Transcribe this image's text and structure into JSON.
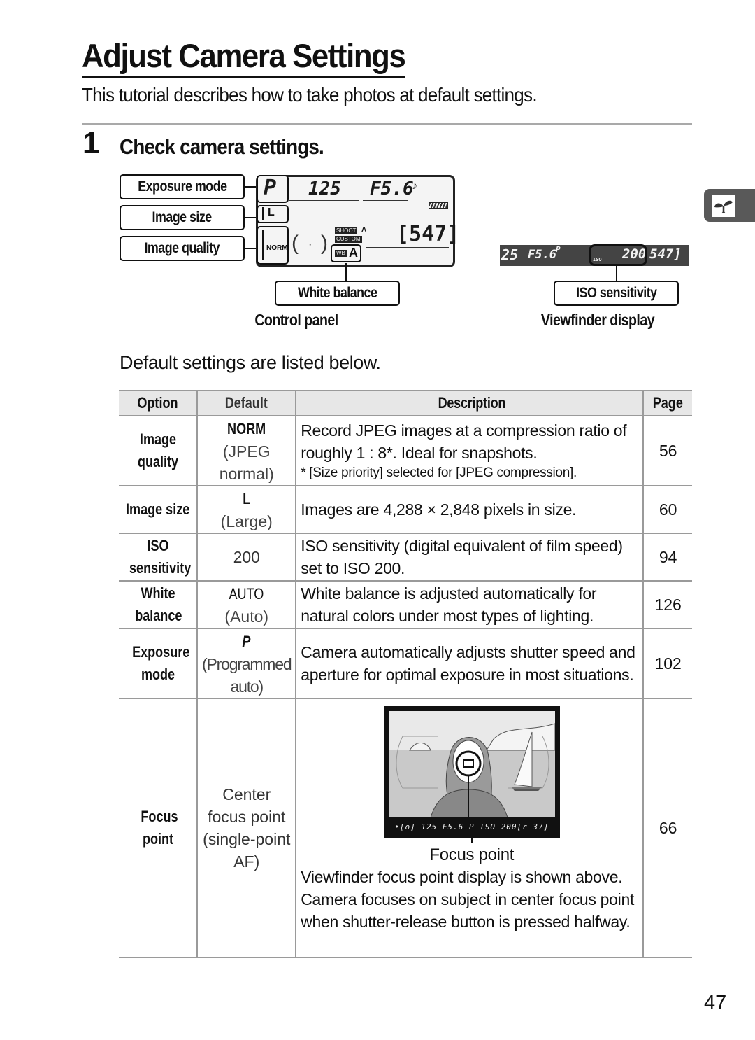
{
  "page": {
    "title": "Adjust Camera Settings",
    "subtitle": "This tutorial describes how to take photos at default settings.",
    "page_number": "47",
    "side_tab_icon": "sprout-icon"
  },
  "step": {
    "number": "1",
    "title": "Check camera settings."
  },
  "control_panel": {
    "caption": "Control panel",
    "callouts": {
      "exposure_mode": "Exposure mode",
      "image_size": "Image size",
      "image_quality": "Image quality",
      "white_balance": "White balance"
    },
    "display": {
      "mode": "P",
      "shutter": "125",
      "aperture": "F5.6",
      "size": "L",
      "quality": "NORM",
      "shoot_tag": "SHOOT",
      "custom_tag": "CUSTOM",
      "bank_a": "A",
      "wb_tag": "WB",
      "wb_value": "A",
      "remaining": "[547]"
    }
  },
  "viewfinder": {
    "caption": "Viewfinder display",
    "callout": "ISO sensitivity",
    "display": {
      "shutter": "25",
      "aperture": "F5.6",
      "mode": "P",
      "iso_label": "ISO",
      "iso_value": "200",
      "remaining": "547]"
    }
  },
  "defaults_intro": "Default settings are listed below.",
  "table": {
    "headers": [
      "Option",
      "Default",
      "Description",
      "Page"
    ],
    "rows": [
      {
        "option": "Image quality",
        "default_code": "NORM",
        "default_text": "(JPEG normal)",
        "description": "Record JPEG images at a compression ratio of roughly 1 : 8*.  Ideal for snapshots.",
        "footnote": "* [Size priority] selected for [JPEG compression].",
        "page": "56"
      },
      {
        "option": "Image size",
        "default_code": "L",
        "default_text": "(Large)",
        "description": "Images are 4,288 × 2,848 pixels in size.",
        "page": "60"
      },
      {
        "option": "ISO sensitivity",
        "default_code": "",
        "default_text": "200",
        "description": "ISO sensitivity (digital equivalent of film speed) set to ISO 200.",
        "page": "94"
      },
      {
        "option": "White balance",
        "default_code": "AUTO",
        "default_text": "(Auto)",
        "description": "White balance is adjusted automatically for natural colors under most types of lighting.",
        "page": "126"
      },
      {
        "option": "Exposure mode",
        "default_code": "P",
        "default_text": "(Programmed auto)",
        "description": "Camera automatically adjusts shutter speed and aperture for optimal exposure in most situations.",
        "page": "102"
      },
      {
        "option": "Focus point",
        "default_code": "",
        "default_text": "Center focus point (single-point AF)",
        "image_caption": "Focus point",
        "image_readout": "•[o]  125  F5.6 P    ISO  200[r 37]",
        "description": "Viewfinder focus point display is shown above.  Camera focuses on subject in center focus point when shutter-release button is pressed halfway.",
        "page": "66"
      }
    ]
  }
}
